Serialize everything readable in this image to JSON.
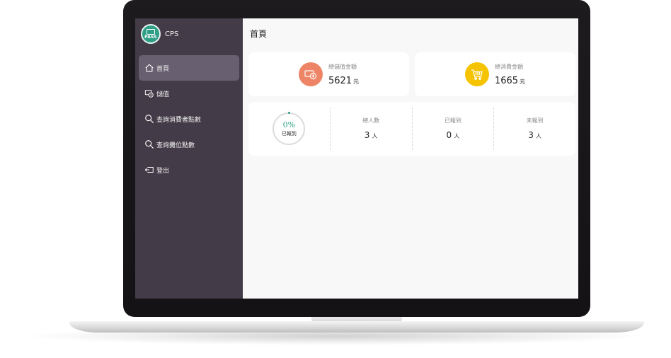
{
  "app": {
    "name": "CPS",
    "logo_text": "PASS"
  },
  "nav": [
    {
      "label": "首頁",
      "icon": "home-icon",
      "active": true
    },
    {
      "label": "儲值",
      "icon": "deposit-icon",
      "active": false
    },
    {
      "label": "查詢消費者點數",
      "icon": "search-icon",
      "active": false
    },
    {
      "label": "查詢攤位點數",
      "icon": "search-icon",
      "active": false
    },
    {
      "label": "登出",
      "icon": "logout-icon",
      "active": false
    }
  ],
  "page": {
    "title": "首頁"
  },
  "stats": {
    "deposit": {
      "label": "總儲值金額",
      "value": "5621",
      "unit": "元",
      "color": "#ee8466",
      "icon": "money-icon"
    },
    "spending": {
      "label": "總消費金額",
      "value": "1665",
      "unit": "元",
      "color": "#f5c300",
      "icon": "cart-icon"
    }
  },
  "report": {
    "progress": {
      "percent": "0%",
      "label": "已報到",
      "color": "#2f9e87"
    },
    "total": {
      "label": "總人數",
      "value": "3",
      "unit": "人"
    },
    "checked_in": {
      "label": "已報到",
      "value": "0",
      "unit": "人"
    },
    "not_checked_in": {
      "label": "未報到",
      "value": "3",
      "unit": "人"
    }
  },
  "colors": {
    "sidebar": "#433b47",
    "sidebar_active": "#686070",
    "accent": "#2f9e87"
  }
}
